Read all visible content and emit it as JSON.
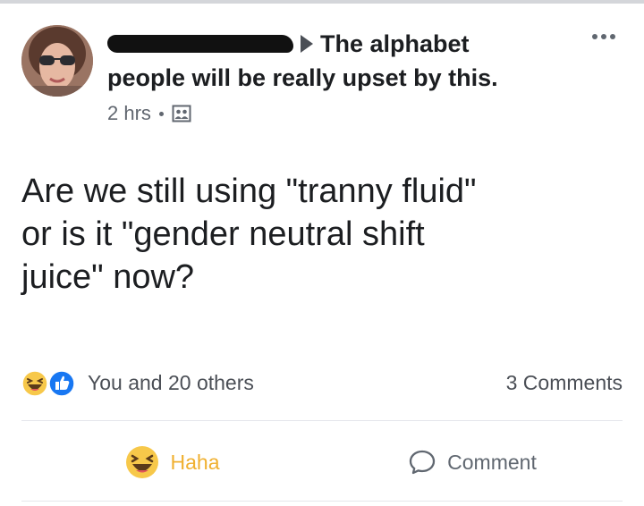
{
  "post": {
    "author_redacted": true,
    "target_label": "The alphabet",
    "headline_rest": "people will be really upset by this.",
    "time": "2 hrs",
    "audience_icon": "friends-icon",
    "text": "Are we still using \"tranny fluid\"\nor is it \"gender neutral shift\njuice\" now?",
    "reactions_summary": "You and 20 others",
    "comments_summary": "3 Comments"
  },
  "actions": {
    "haha_label": "Haha",
    "comment_label": "Comment"
  },
  "colors": {
    "haha_accent": "#f0b030",
    "like_blue": "#1877f2",
    "text_primary": "#1c1e21",
    "text_secondary": "#616770"
  }
}
